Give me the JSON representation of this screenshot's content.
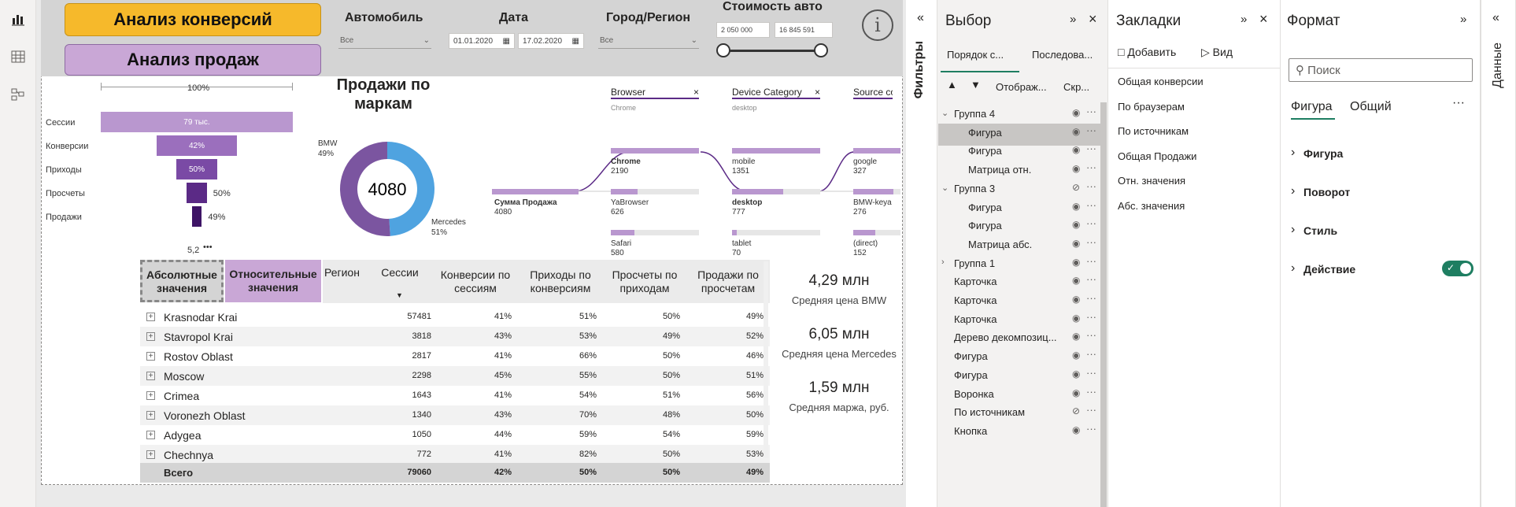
{
  "report": {
    "btn_conversion": "Анализ конверсий",
    "btn_sales": "Анализ продаж",
    "slicers": {
      "car_label": "Автомобиль",
      "car_value": "Все",
      "date_label": "Дата",
      "date_from": "01.01.2020",
      "date_to": "17.02.2020",
      "city_label": "Город/Регион",
      "city_value": "Все",
      "price_label": "Стоимость авто",
      "price_min": "2 050 000",
      "price_max": "16 845 591"
    },
    "info_icon": "i"
  },
  "funnel": {
    "top_label": "100%",
    "stages": [
      {
        "label": "Сессии",
        "value": "79 тыс.",
        "fraction": 1.0
      },
      {
        "label": "Конверсии",
        "value": "42%",
        "fraction": 0.42
      },
      {
        "label": "Приходы",
        "value": "50%",
        "fraction": 0.21
      },
      {
        "label": "Просчеты",
        "value": "50%",
        "fraction": 0.105
      },
      {
        "label": "Продажи",
        "value": "49%",
        "fraction": 0.052
      }
    ],
    "bottom_value": "5,2"
  },
  "donut": {
    "title": "Продажи по маркам",
    "center": "4080",
    "slices": [
      {
        "name": "BMW",
        "pct": "49%",
        "value": 49,
        "color": "#7b55a0"
      },
      {
        "name": "Mercedes",
        "pct": "51%",
        "value": 51,
        "color": "#4fa3e0"
      }
    ]
  },
  "decomp": {
    "cols": [
      {
        "name": "Browser",
        "sub": "Chrome"
      },
      {
        "name": "Device Category",
        "sub": "desktop"
      },
      {
        "name": "Source co",
        "sub": ""
      }
    ],
    "root": {
      "label": "Сумма Продажа",
      "value": "4080"
    },
    "browser": [
      {
        "label": "Chrome",
        "value": "2190"
      },
      {
        "label": "YaBrowser",
        "value": "626"
      },
      {
        "label": "Safari",
        "value": "580"
      }
    ],
    "device": [
      {
        "label": "mobile",
        "value": "1351"
      },
      {
        "label": "desktop",
        "value": "777"
      },
      {
        "label": "tablet",
        "value": "70"
      }
    ],
    "source": [
      {
        "label": "google",
        "value": "327"
      },
      {
        "label": "BMW-keya",
        "value": "276"
      },
      {
        "label": "(direct)",
        "value": "152"
      }
    ]
  },
  "table": {
    "toggle_abs": "Абсолютные значения",
    "toggle_rel": "Относительные значения",
    "headers": [
      "Регион",
      "Сессии",
      "Конверсии по сессиям",
      "Приходы по конверсиям",
      "Просчеты по приходам",
      "Продажи по просчетам"
    ],
    "rows": [
      [
        "Krasnodar Krai",
        "57481",
        "41%",
        "51%",
        "50%",
        "49%"
      ],
      [
        "Stavropol Krai",
        "3818",
        "43%",
        "53%",
        "49%",
        "52%"
      ],
      [
        "Rostov Oblast",
        "2817",
        "41%",
        "66%",
        "50%",
        "46%"
      ],
      [
        "Moscow",
        "2298",
        "45%",
        "55%",
        "50%",
        "51%"
      ],
      [
        "Crimea",
        "1643",
        "41%",
        "54%",
        "51%",
        "56%"
      ],
      [
        "Voronezh Oblast",
        "1340",
        "43%",
        "70%",
        "48%",
        "50%"
      ],
      [
        "Adygea",
        "1050",
        "44%",
        "59%",
        "54%",
        "59%"
      ],
      [
        "Chechnya",
        "772",
        "41%",
        "82%",
        "50%",
        "53%"
      ]
    ],
    "total": [
      "Всего",
      "79060",
      "42%",
      "50%",
      "50%",
      "49%"
    ]
  },
  "cards": [
    {
      "value": "4,29 млн",
      "label": "Средняя цена BMW"
    },
    {
      "value": "6,05 млн",
      "label": "Средняя цена Mercedes"
    },
    {
      "value": "1,59 млн",
      "label": "Средняя маржа, руб."
    }
  ],
  "filters_pane": {
    "title": "Фильтры"
  },
  "selection_pane": {
    "title": "Выбор",
    "tab_order": "Порядок с...",
    "tab_seq": "Последова...",
    "show": "Отображ...",
    "hide": "Скр...",
    "items": [
      {
        "label": "Группа 4",
        "indent": 0,
        "group": true,
        "selected": false,
        "hidden": false
      },
      {
        "label": "Фигура",
        "indent": 1,
        "group": false,
        "selected": true,
        "hidden": false
      },
      {
        "label": "Фигура",
        "indent": 1,
        "group": false,
        "selected": false,
        "hidden": false
      },
      {
        "label": "Матрица отн.",
        "indent": 1,
        "group": false,
        "selected": false,
        "hidden": false
      },
      {
        "label": "Группа 3",
        "indent": 0,
        "group": true,
        "selected": false,
        "hidden": true
      },
      {
        "label": "Фигура",
        "indent": 1,
        "group": false,
        "selected": false,
        "hidden": false
      },
      {
        "label": "Фигура",
        "indent": 1,
        "group": false,
        "selected": false,
        "hidden": false
      },
      {
        "label": "Матрица абс.",
        "indent": 1,
        "group": false,
        "selected": false,
        "hidden": false
      },
      {
        "label": "Группа 1",
        "indent": 0,
        "group": true,
        "collapsed": true,
        "selected": false,
        "hidden": false
      },
      {
        "label": "Карточка",
        "indent": 0,
        "group": false,
        "selected": false,
        "hidden": false
      },
      {
        "label": "Карточка",
        "indent": 0,
        "group": false,
        "selected": false,
        "hidden": false
      },
      {
        "label": "Карточка",
        "indent": 0,
        "group": false,
        "selected": false,
        "hidden": false
      },
      {
        "label": "Дерево декомпозиц...",
        "indent": 0,
        "group": false,
        "selected": false,
        "hidden": false
      },
      {
        "label": "Фигура",
        "indent": 0,
        "group": false,
        "selected": false,
        "hidden": false
      },
      {
        "label": "Фигура",
        "indent": 0,
        "group": false,
        "selected": false,
        "hidden": false
      },
      {
        "label": "Воронка",
        "indent": 0,
        "group": false,
        "selected": false,
        "hidden": false
      },
      {
        "label": "По источникам",
        "indent": 0,
        "group": false,
        "selected": false,
        "hidden": true
      },
      {
        "label": "Кнопка",
        "indent": 0,
        "group": false,
        "selected": false,
        "hidden": false
      }
    ]
  },
  "bookmarks_pane": {
    "title": "Закладки",
    "add": "Добавить",
    "view": "Вид",
    "items": [
      "Общая конверсии",
      "По браузерам",
      "По источникам",
      "Общая Продажи",
      "Отн. значения",
      "Абс. значения"
    ]
  },
  "format_pane": {
    "title": "Формат",
    "search_placeholder": "Поиск",
    "tab_shape": "Фигура",
    "tab_general": "Общий",
    "sections": [
      "Фигура",
      "Поворот",
      "Стиль",
      "Действие"
    ]
  },
  "data_pane": {
    "title": "Данные"
  },
  "colors": {
    "accent_orange": "#f6b92b",
    "accent_purple": "#c9a7d6",
    "funnel_dark": "#5b2a86",
    "toggle_green": "#1e7e61"
  }
}
